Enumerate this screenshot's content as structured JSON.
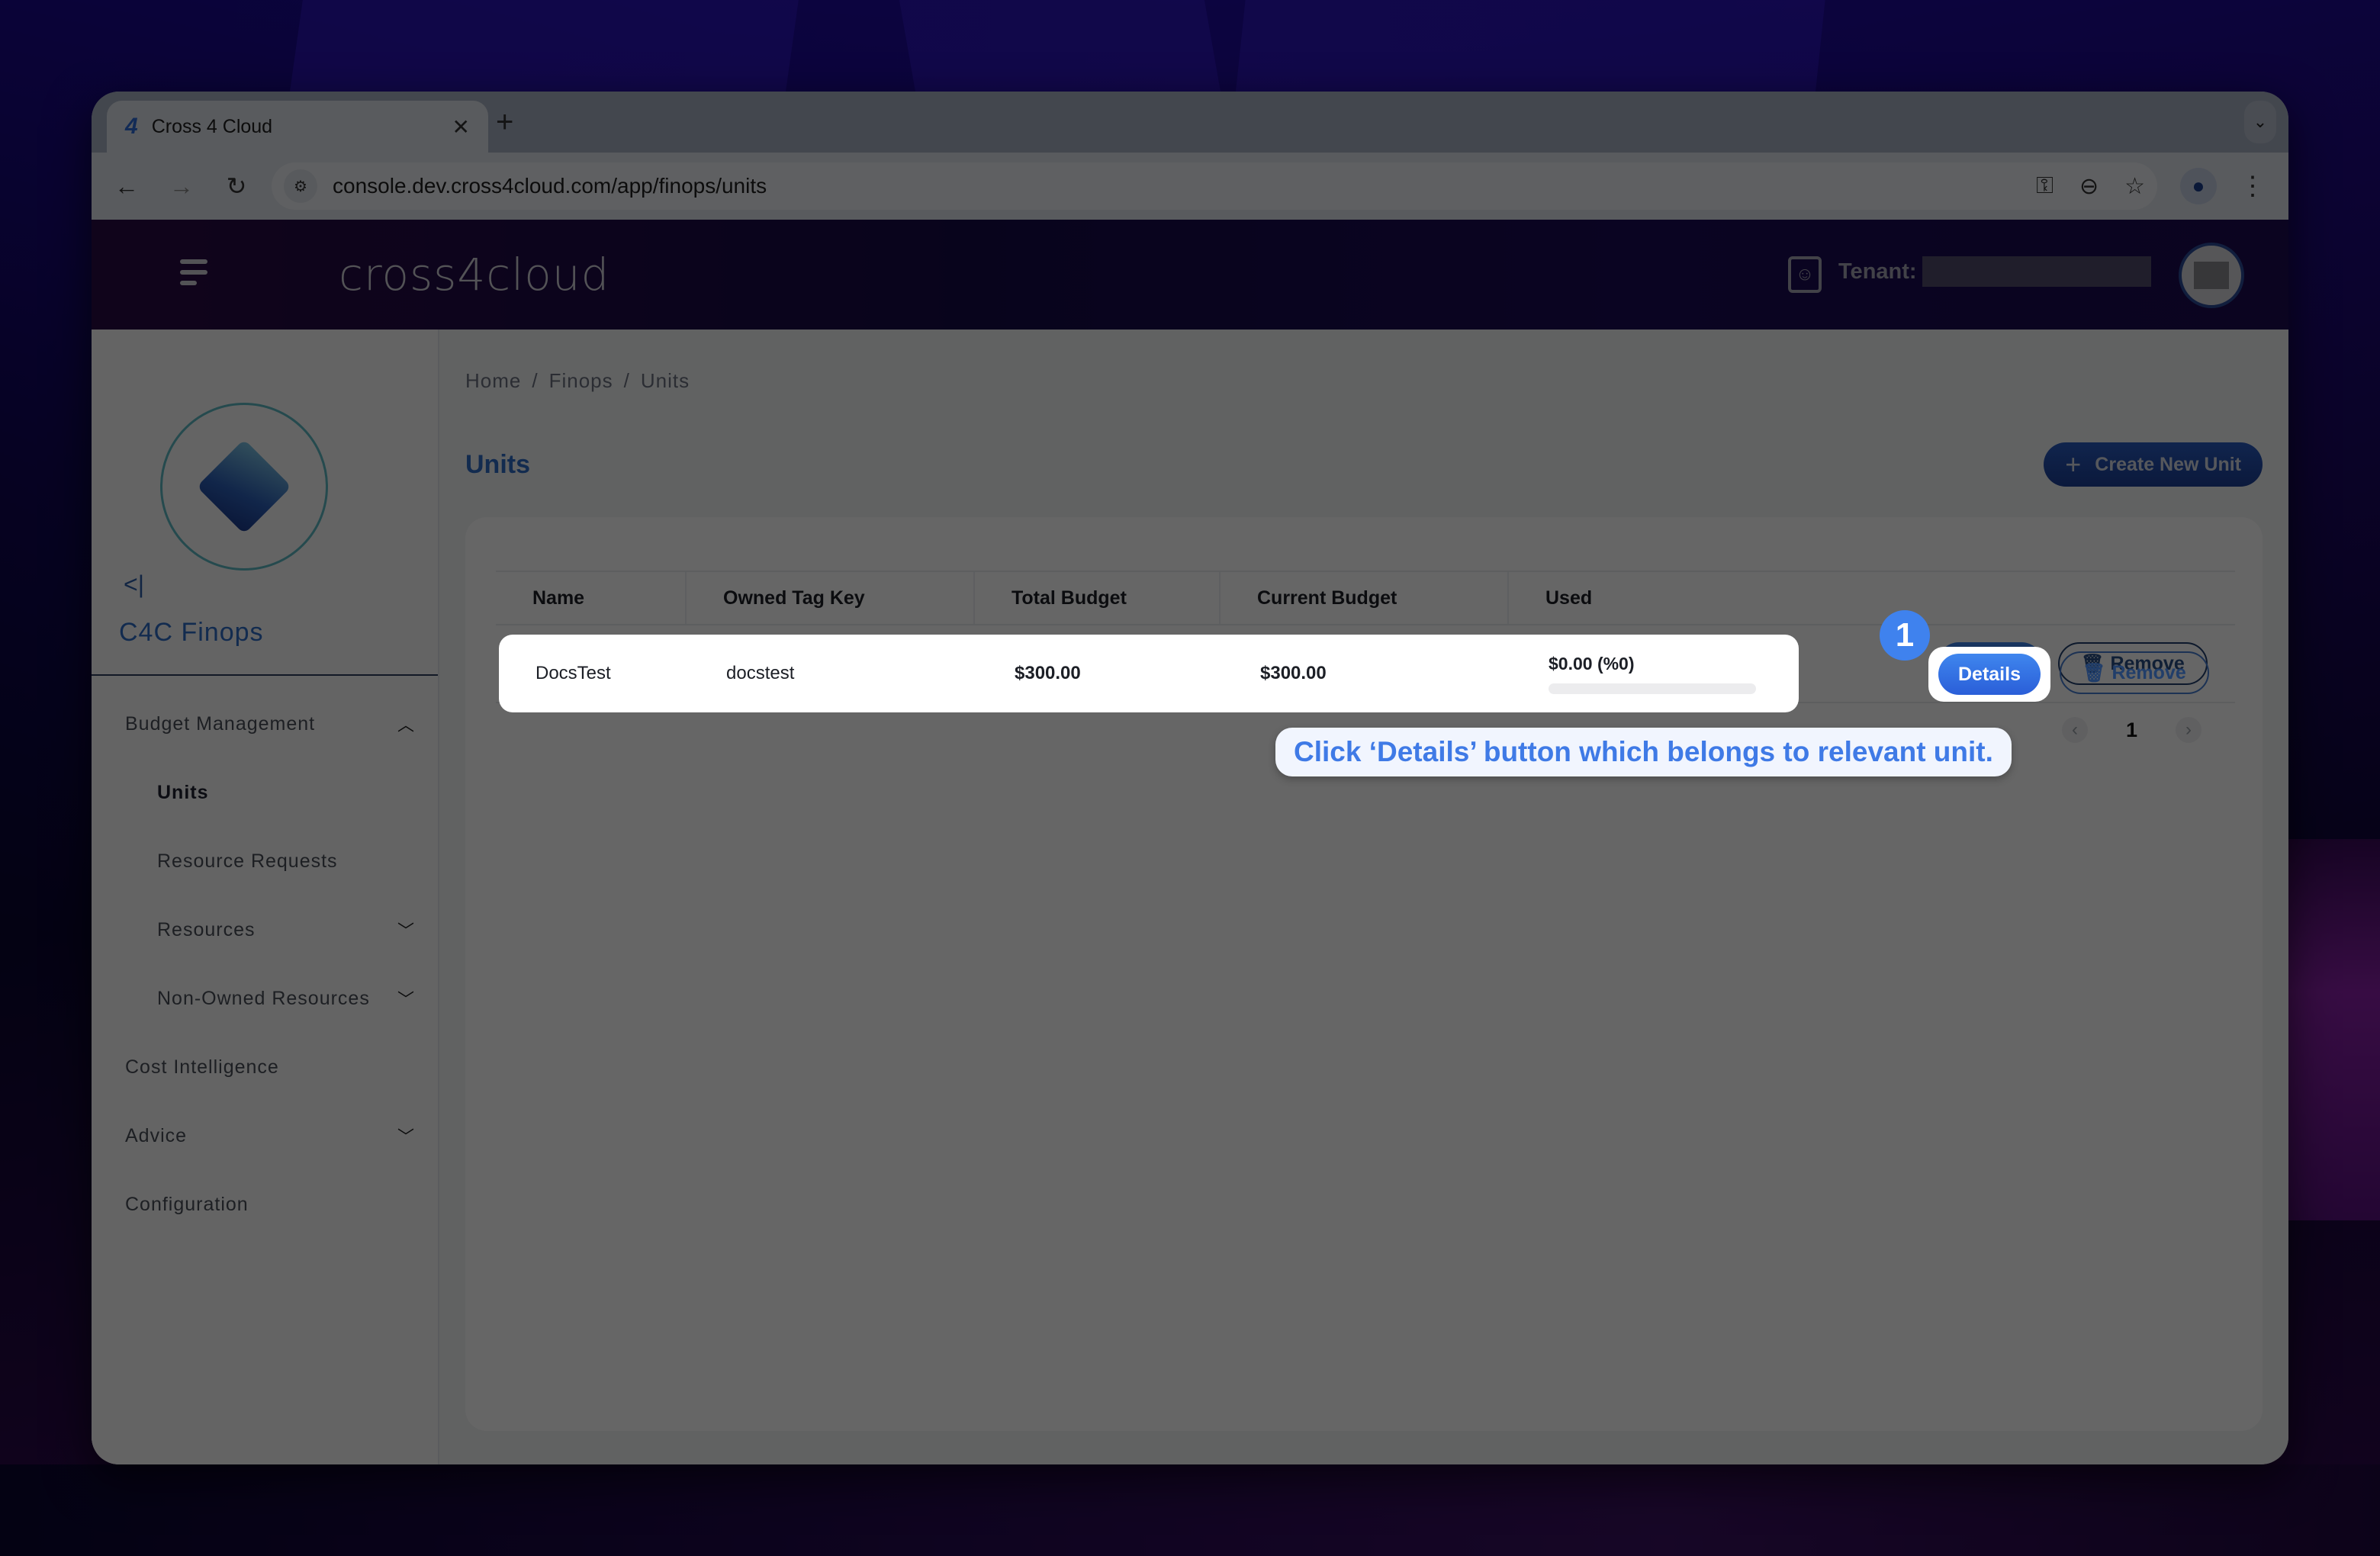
{
  "browser": {
    "tab_title": "Cross 4 Cloud",
    "tab_favicon": "4",
    "url": "console.dev.cross4cloud.com/app/finops/units"
  },
  "app": {
    "logo": "cross4cloud",
    "tenant_label": "Tenant:",
    "tenant_value": ""
  },
  "sidebar": {
    "title": "C4C Finops",
    "collapse_glyph": "<|",
    "items": [
      {
        "label": "Budget Management",
        "level": 0,
        "chevron": "up"
      },
      {
        "label": "Units",
        "level": 1,
        "active": true
      },
      {
        "label": "Resource Requests",
        "level": 1
      },
      {
        "label": "Resources",
        "level": 1,
        "chevron": "down"
      },
      {
        "label": "Non-Owned Resources",
        "level": 1,
        "chevron": "down"
      },
      {
        "label": "Cost Intelligence",
        "level": 0
      },
      {
        "label": "Advice",
        "level": 0,
        "chevron": "down"
      },
      {
        "label": "Configuration",
        "level": 0
      }
    ]
  },
  "main": {
    "breadcrumb": [
      "Home",
      "Finops",
      "Units"
    ],
    "breadcrumb_sep": "/",
    "page_title": "Units",
    "create_button": "Create New Unit",
    "table": {
      "columns": [
        "Name",
        "Owned Tag Key",
        "Total Budget",
        "Current Budget",
        "Used"
      ],
      "rows": [
        {
          "name": "DocsTest",
          "owned_tag_key": "docstest",
          "total_budget": "$300.00",
          "current_budget": "$300.00",
          "used_text": "$0.00 (%0)",
          "used_fraction": 0,
          "details_label": "Details",
          "remove_label": "Remove"
        }
      ]
    },
    "pagination": {
      "current_page": "1",
      "prev": "‹",
      "next": "›"
    }
  },
  "annotation": {
    "step_number": "1",
    "tooltip": "Click ‘Details’ button which belongs to relevant unit."
  }
}
